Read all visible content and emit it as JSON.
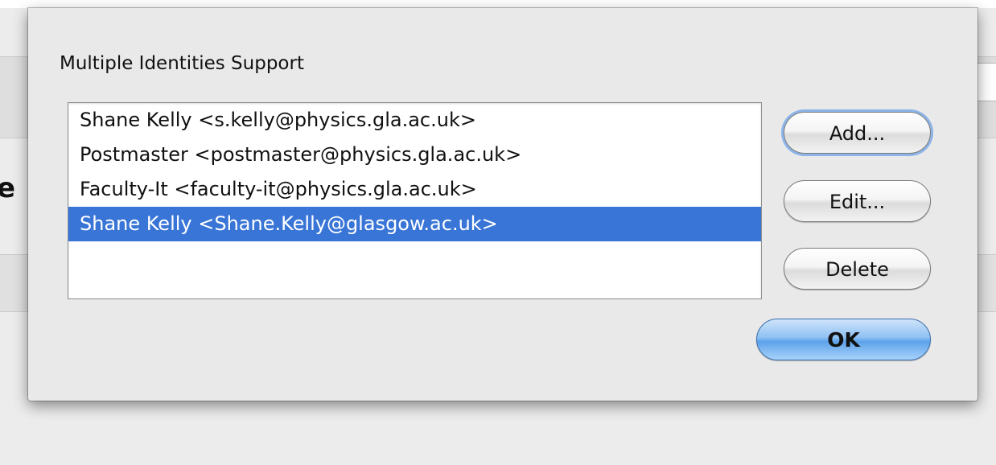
{
  "sheet": {
    "title": "Multiple Identities Support"
  },
  "identities": [
    {
      "label": "Shane Kelly <s.kelly@physics.gla.ac.uk>",
      "selected": false
    },
    {
      "label": "Postmaster <postmaster@physics.gla.ac.uk>",
      "selected": false
    },
    {
      "label": "Faculty-It <faculty-it@physics.gla.ac.uk>",
      "selected": false
    },
    {
      "label": "Shane Kelly <Shane.Kelly@glasgow.ac.uk>",
      "selected": true
    }
  ],
  "buttons": {
    "add": "Add...",
    "edit": "Edit...",
    "delete": "Delete",
    "ok": "OK"
  },
  "background": {
    "heading_fragment": "e"
  },
  "colors": {
    "selection": "#3875d7",
    "default_button": "#5da2ea"
  }
}
